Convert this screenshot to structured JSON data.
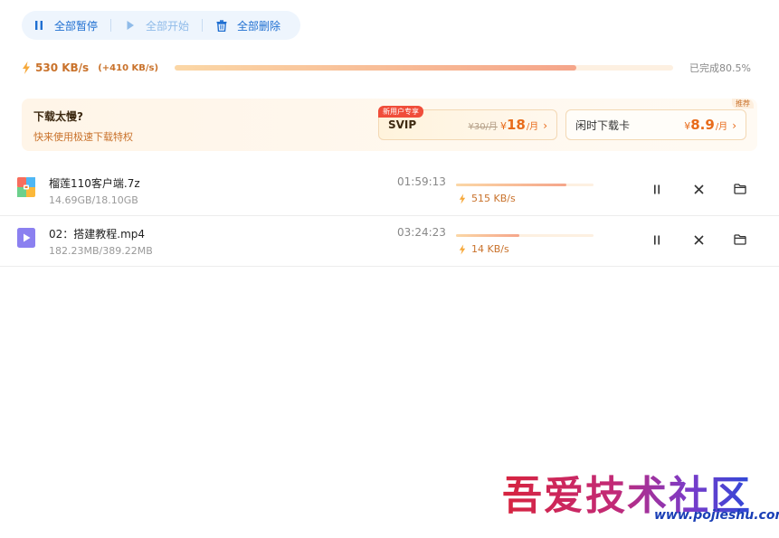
{
  "toolbar": {
    "pause_all": "全部暂停",
    "start_all": "全部开始",
    "delete_all": "全部删除"
  },
  "summary": {
    "speed": "530 KB/s",
    "speed_delta": "(+410 KB/s)",
    "progress_percent": 80.5,
    "completed_text": "已完成80.5%"
  },
  "promo": {
    "title": "下载太慢?",
    "subtitle": "快来使用极速下载特权",
    "badge_new": "新用户专享",
    "badge_recommend": "推荐",
    "svip": {
      "name": "SVIP",
      "old_price": "¥30/月",
      "currency": "¥",
      "price": "18",
      "unit": "/月"
    },
    "idle_card": {
      "name": "闲时下载卡",
      "currency": "¥",
      "price": "8.9",
      "unit": "/月"
    }
  },
  "tasks": [
    {
      "name": "榴莲110客户端.7z",
      "size": "14.69GB/18.10GB",
      "eta": "01:59:13",
      "speed": "515 KB/s",
      "progress_percent": 80,
      "icon": "archive-file-icon"
    },
    {
      "name": "02：搭建教程.mp4",
      "size": "182.23MB/389.22MB",
      "eta": "03:24:23",
      "speed": "14 KB/s",
      "progress_percent": 46,
      "icon": "video-file-icon"
    }
  ],
  "watermark": {
    "title": "吾爱技术社区",
    "url": "www.pojieshu.com"
  },
  "colors": {
    "accent_blue": "#1f6fd1",
    "speed_orange": "#c9722b",
    "price_orange": "#e86b1a",
    "badge_red": "#f04d3a"
  }
}
